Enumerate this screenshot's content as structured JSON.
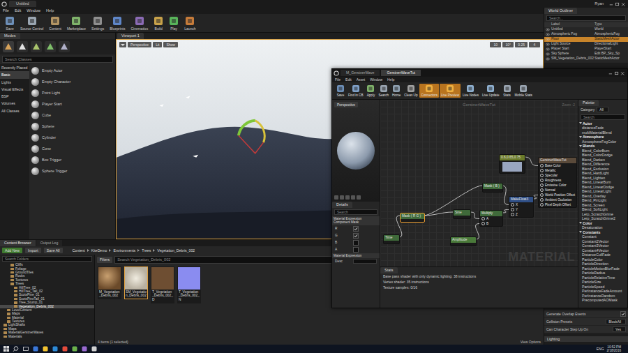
{
  "editor": {
    "tab": "Untitled",
    "user": "Ryan",
    "menu": [
      "File",
      "Edit",
      "Window",
      "Help"
    ]
  },
  "toolbar": [
    "Save",
    "Source Control",
    "Content",
    "Marketplace",
    "Settings",
    "Blueprints",
    "Cinematics",
    "Build",
    "Play",
    "Launch"
  ],
  "modes": {
    "title": "Modes",
    "search": "Search Classes",
    "categories": [
      {
        "label": "Recently Placed",
        "selected": false
      },
      {
        "label": "Basic",
        "selected": true
      },
      {
        "label": "Lights",
        "selected": false
      },
      {
        "label": "Visual Effects",
        "selected": false
      },
      {
        "label": "BSP",
        "selected": false
      },
      {
        "label": "Volumes",
        "selected": false
      },
      {
        "label": "All Classes",
        "selected": false
      }
    ],
    "items": [
      "Empty Actor",
      "Empty Character",
      "Point Light",
      "Player Start",
      "Cube",
      "Sphere",
      "Cylinder",
      "Cone",
      "Box Trigger",
      "Sphere Trigger"
    ]
  },
  "viewport": {
    "title": "Viewport 1",
    "view": "Perspective",
    "mode": "Lit",
    "show": "Show",
    "snaps": [
      "10",
      "10°",
      "0.25",
      "4"
    ]
  },
  "outliner": {
    "title": "World Outliner",
    "search": "Search...",
    "columns": [
      "Label",
      "Type"
    ],
    "rows": [
      {
        "label": "Untitled",
        "type": "World",
        "selected": false
      },
      {
        "label": "Atmospheric Fog",
        "type": "AtmosphericFog",
        "selected": false
      },
      {
        "label": "Floor",
        "type": "StaticMeshActor",
        "selected": true
      },
      {
        "label": "Light Source",
        "type": "DirectionalLight",
        "selected": false
      },
      {
        "label": "Player Start",
        "type": "PlayerStart",
        "selected": false
      },
      {
        "label": "Sky Sphere",
        "type": "Edit BP_Sky_Sp",
        "selected": false
      },
      {
        "label": "SM_Vegetation_Debris_002",
        "type": "StaticMeshActor",
        "selected": false
      }
    ]
  },
  "details": {
    "rows": [
      {
        "kind": "check",
        "label": "Generate Overlap Events",
        "checked": true
      },
      {
        "kind": "select",
        "label": "Collision Presets",
        "value": "BlockAll"
      },
      {
        "kind": "select",
        "label": "Can Character Step Up On",
        "value": "Yes"
      }
    ],
    "section": "Lighting"
  },
  "content_browser": {
    "tabs": [
      {
        "label": "Content Browser",
        "selected": true
      },
      {
        "label": "Output Log",
        "selected": false
      }
    ],
    "buttons": [
      "Add New",
      "Import",
      "Save All"
    ],
    "path": [
      "Content",
      "KiteDemo",
      "Environments",
      "Trees",
      "Vegetation_Debris_002"
    ],
    "tree_search": "Search Folders",
    "tree": [
      {
        "label": "Cliffs",
        "depth": 3,
        "selected": false
      },
      {
        "label": "Foliage",
        "depth": 3,
        "selected": false
      },
      {
        "label": "GroundTiles",
        "depth": 3,
        "selected": false
      },
      {
        "label": "Rocks",
        "depth": 3,
        "selected": false
      },
      {
        "label": "Textures",
        "depth": 3,
        "selected": false
      },
      {
        "label": "Trees",
        "depth": 3,
        "selected": false
      },
      {
        "label": "HillTree_02",
        "depth": 4,
        "selected": false
      },
      {
        "label": "HillTree_Tall_02",
        "depth": 4,
        "selected": false
      },
      {
        "label": "ScotsPine_01",
        "depth": 4,
        "selected": false
      },
      {
        "label": "ScotsPineTall_01",
        "depth": 4,
        "selected": false
      },
      {
        "label": "Tree_Stump_01",
        "depth": 4,
        "selected": false
      },
      {
        "label": "Vegetation_Debris_002",
        "depth": 4,
        "selected": true
      },
      {
        "label": "LevelContent",
        "depth": 2,
        "selected": false
      },
      {
        "label": "Maps",
        "depth": 2,
        "selected": false
      },
      {
        "label": "Material",
        "depth": 2,
        "selected": false
      },
      {
        "label": "Textures",
        "depth": 2,
        "selected": false
      },
      {
        "label": "LightShafts",
        "depth": 1,
        "selected": false
      },
      {
        "label": "Maps",
        "depth": 1,
        "selected": false
      },
      {
        "label": "MaterialGerstnerWaves",
        "depth": 1,
        "selected": false
      },
      {
        "label": "Materials",
        "depth": 1,
        "selected": false
      }
    ],
    "filters": "Filters",
    "search": "Search Vegetation_Debris_002",
    "assets": [
      {
        "name": "M_Vegetation_Debris_002",
        "kind": "material",
        "selected": false
      },
      {
        "name": "SM_Vegetation_Debris_002",
        "kind": "mesh",
        "selected": true
      },
      {
        "name": "T_Vegetation_Debris_002_D",
        "kind": "diffuse",
        "selected": false
      },
      {
        "name": "T_Vegetation_Debris_002_N",
        "kind": "normal",
        "selected": false
      }
    ],
    "count": "4 items (1 selected)",
    "view_options": "View Options"
  },
  "material_editor": {
    "tabs": [
      {
        "label": "M_GerstnerWave",
        "selected": false
      },
      {
        "label": "GerstnerWaveTut",
        "selected": true
      }
    ],
    "menu": [
      "File",
      "Edit",
      "Asset",
      "Window",
      "Help"
    ],
    "toolbar": [
      {
        "label": "Save",
        "active": false
      },
      {
        "label": "Find in CB",
        "active": false
      },
      {
        "label": "Apply",
        "active": false
      },
      {
        "label": "Search",
        "active": false
      },
      {
        "label": "Home",
        "active": false
      },
      {
        "label": "Clean Up",
        "active": false
      },
      {
        "label": "Connectors",
        "active": true
      },
      {
        "label": "Live Preview",
        "active": true
      },
      {
        "label": "Live Nodes",
        "active": false
      },
      {
        "label": "Live Update",
        "active": false
      },
      {
        "label": "Stats",
        "active": false
      },
      {
        "label": "Mobile Stats",
        "active": false
      }
    ],
    "preview": {
      "view": "Perspective"
    },
    "details": {
      "title": "Details",
      "search": "Search",
      "sections": [
        {
          "title": "Material Expression Component Mask",
          "rows": [
            {
              "kind": "check",
              "label": "R",
              "checked": true
            },
            {
              "kind": "check",
              "label": "G",
              "checked": true
            },
            {
              "kind": "check",
              "label": "B",
              "checked": false
            },
            {
              "kind": "check",
              "label": "A",
              "checked": false
            }
          ]
        },
        {
          "title": "Material Expression",
          "rows": [
            {
              "kind": "field",
              "label": "Desc"
            }
          ]
        }
      ]
    },
    "graph": {
      "title": "GerstnerWaveTut",
      "zoom": "Zoom -2",
      "watermark": "MATERIAL",
      "nodes": [
        {
          "title": "GerstnerWaveTut",
          "kind": "result",
          "selected": false,
          "pins": [
            "Base Color",
            "Metallic",
            "Specular",
            "Roughness",
            "Emissive Color",
            "Normal",
            "World Position Offset",
            "Ambient Occlusion",
            "Pixel Depth Offset"
          ]
        },
        {
          "title": "0.6,0.65,0.75",
          "kind": "vector",
          "selected": false,
          "pins": []
        },
        {
          "title": "MakeFloat3",
          "kind": "function",
          "selected": false,
          "pins": [
            "X",
            "Y",
            "Z"
          ]
        },
        {
          "title": "Mask ( B )",
          "kind": "math",
          "selected": false,
          "pins": []
        },
        {
          "title": "Sine",
          "kind": "math",
          "selected": false,
          "pins": []
        },
        {
          "title": "Multiply",
          "kind": "math",
          "selected": false,
          "pins": [
            "A",
            "B"
          ]
        },
        {
          "title": "Mask ( R G )",
          "kind": "math",
          "selected": true,
          "pins": []
        },
        {
          "title": "Time",
          "kind": "math",
          "selected": false,
          "pins": []
        },
        {
          "title": "Amplitude",
          "kind": "param",
          "selected": false,
          "pins": []
        }
      ],
      "links": [
        {
          "from": 7,
          "to": 6,
          "pin": 0
        },
        {
          "from": 6,
          "to": 4,
          "pin": 0
        },
        {
          "from": 6,
          "to": 3,
          "pin": 0
        },
        {
          "from": 4,
          "to": 5,
          "pin": 0
        },
        {
          "from": 8,
          "to": 5,
          "pin": 1
        },
        {
          "from": 3,
          "to": 2,
          "pin": 0
        },
        {
          "from": 5,
          "to": 2,
          "pin": 1
        },
        {
          "from": 2,
          "to": 0,
          "pin": 6
        },
        {
          "from": 1,
          "to": 0,
          "pin": 0
        }
      ]
    },
    "stats": {
      "title": "Stats",
      "lines": [
        "Base pass shader with only dynamic lighting: 38 instructions",
        "Vertex shader: 35 instructions",
        "Texture samples: 0/16"
      ]
    },
    "palette": {
      "title": "Palette",
      "category_label": "Category",
      "category": "All",
      "search": "Search",
      "items": [
        {
          "label": "Actor",
          "kind": "category"
        },
        {
          "label": "distanceFade",
          "kind": "item"
        },
        {
          "label": "multiMaterialBlend",
          "kind": "item"
        },
        {
          "label": "Atmosphere",
          "kind": "category"
        },
        {
          "label": "AtmosphereFogColor",
          "kind": "item"
        },
        {
          "label": "Blends",
          "kind": "category"
        },
        {
          "label": "Blend_ColorBurn",
          "kind": "item"
        },
        {
          "label": "Blend_ColorDodge",
          "kind": "item"
        },
        {
          "label": "Blend_Darken",
          "kind": "item"
        },
        {
          "label": "Blend_Difference",
          "kind": "item"
        },
        {
          "label": "Blend_Exclusion",
          "kind": "item"
        },
        {
          "label": "Blend_HardLight",
          "kind": "item"
        },
        {
          "label": "Blend_Lighten",
          "kind": "item"
        },
        {
          "label": "Blend_LinearBurn",
          "kind": "item"
        },
        {
          "label": "Blend_LinearDodge",
          "kind": "item"
        },
        {
          "label": "Blend_LinearLight",
          "kind": "item"
        },
        {
          "label": "Blend_Overlay",
          "kind": "item"
        },
        {
          "label": "Blend_PinLight",
          "kind": "item"
        },
        {
          "label": "Blend_Screen",
          "kind": "item"
        },
        {
          "label": "Blend_SoftLight",
          "kind": "item"
        },
        {
          "label": "Lerp_ScratchGrime",
          "kind": "item"
        },
        {
          "label": "Lerp_ScratchGrime2",
          "kind": "item"
        },
        {
          "label": "Color",
          "kind": "category"
        },
        {
          "label": "Desaturation",
          "kind": "item"
        },
        {
          "label": "Constants",
          "kind": "category"
        },
        {
          "label": "Constant",
          "kind": "item"
        },
        {
          "label": "Constant2Vector",
          "kind": "item"
        },
        {
          "label": "Constant3Vector",
          "kind": "item"
        },
        {
          "label": "Constant4Vector",
          "kind": "item"
        },
        {
          "label": "DistanceCullFade",
          "kind": "item"
        },
        {
          "label": "ParticleColor",
          "kind": "item"
        },
        {
          "label": "ParticleDirection",
          "kind": "item"
        },
        {
          "label": "ParticleMotionBlurFade",
          "kind": "item"
        },
        {
          "label": "ParticleRadius",
          "kind": "item"
        },
        {
          "label": "ParticleRelativeTime",
          "kind": "item"
        },
        {
          "label": "ParticleSize",
          "kind": "item"
        },
        {
          "label": "ParticleSpeed",
          "kind": "item"
        },
        {
          "label": "PerInstanceFadeAmount",
          "kind": "item"
        },
        {
          "label": "PerInstanceRandom",
          "kind": "item"
        },
        {
          "label": "PrecomputedAOMask",
          "kind": "item"
        }
      ]
    }
  },
  "taskbar": {
    "lang": "ENG",
    "time": "10:52 PM",
    "date": "2/18/2016"
  }
}
